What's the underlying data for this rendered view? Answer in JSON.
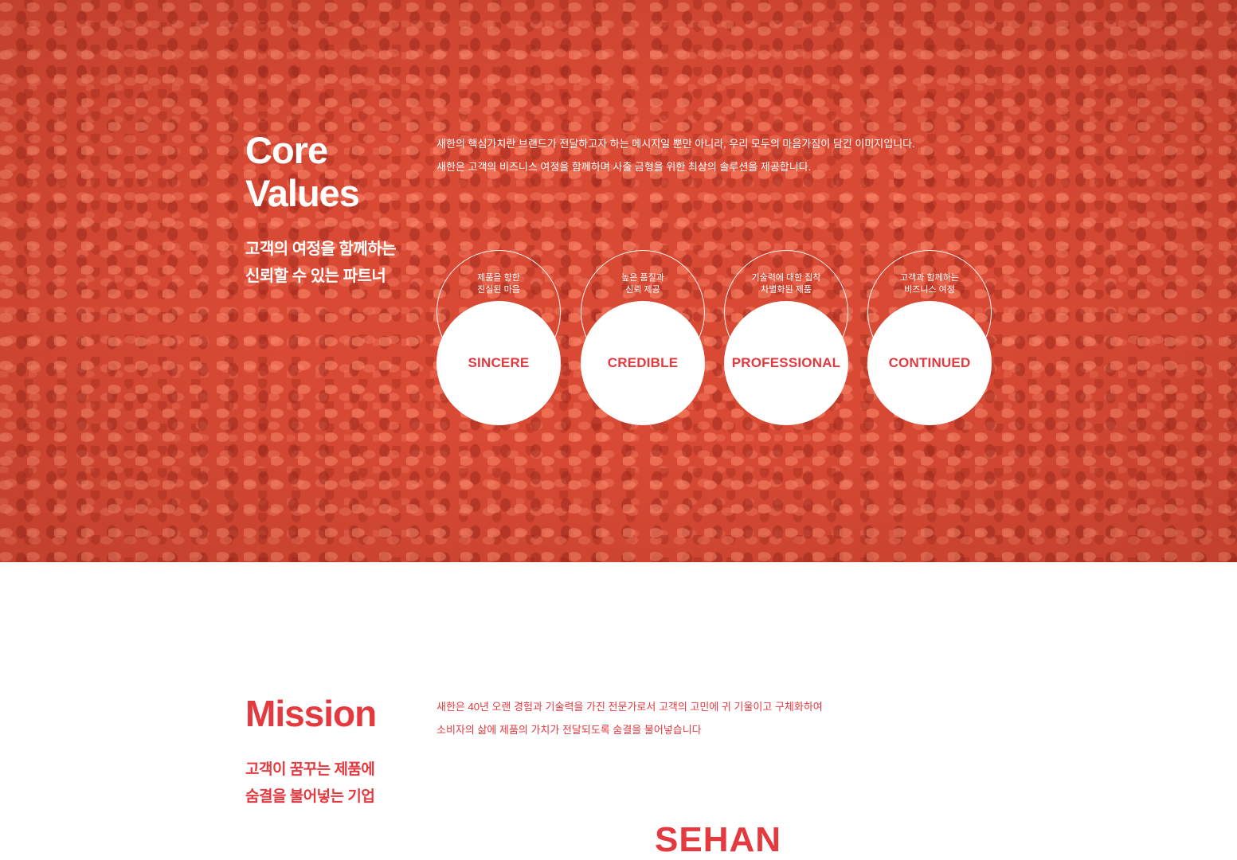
{
  "core_values": {
    "title_line1": "Core",
    "title_line2": "Values",
    "subtitle_line1": "고객의 여정을 함께하는",
    "subtitle_line2": "신뢰할 수 있는 파트너",
    "description_line1": "새한의 핵심가치란 브랜드가 전달하고자 하는 메시지일 뿐만 아니라, 우리 모두의 마음가짐이 담긴 이미지입니다.",
    "description_line2": "새한은 고객의 비즈니스 여정을 함께하며 사출 금형을 위한 최상의 솔루션을 제공합니다.",
    "items": [
      {
        "caption_line1": "제품을 향한",
        "caption_line2": "진실된 마음",
        "label": "SINCERE"
      },
      {
        "caption_line1": "높은 품질과",
        "caption_line2": "신뢰 제공",
        "label": "CREDIBLE"
      },
      {
        "caption_line1": "기술력에 대한 집착",
        "caption_line2": "차별화된 제품",
        "label": "PROFESSIONAL"
      },
      {
        "caption_line1": "고객과 함께하는",
        "caption_line2": "비즈니스 여정",
        "label": "CONTINUED"
      }
    ]
  },
  "mission": {
    "title": "Mission",
    "subtitle_line1": "고객이 꿈꾸는 제품에",
    "subtitle_line2": "숨결을 불어넣는 기업",
    "description_line1": "새한은 40년 오랜 경험과 기술력을 가진 전문가로서 고객의 고민에 귀 기울이고 구체화하여",
    "description_line2": "소비자의 삶에 제품의 가치가 전달되도록 숨결을 불어넣습니다",
    "brand_text": "SEHAN"
  },
  "colors": {
    "accent": "#e3393f",
    "hero_background": "#d94a35",
    "white": "#ffffff"
  }
}
